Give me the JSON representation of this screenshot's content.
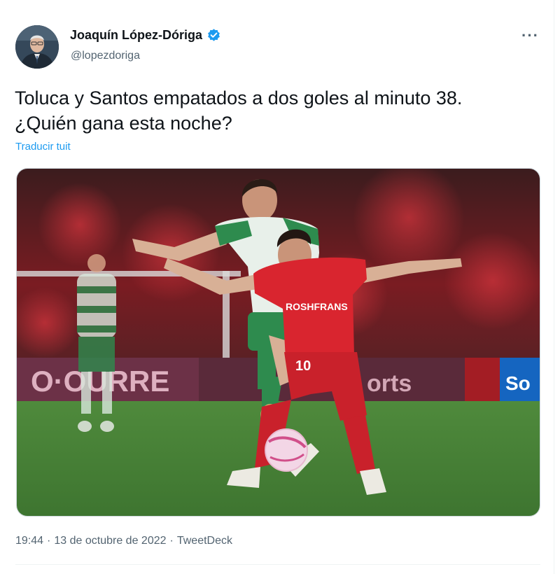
{
  "tweet": {
    "author_name": "Joaquín López-Dóriga",
    "author_handle": "@lopezdoriga",
    "text": "Toluca y Santos empatados a dos goles al minuto 38.\n¿Quién gana esta noche?",
    "translate_label": "Traducir tuit",
    "time": "19:44",
    "separator": "·",
    "date": "13 de octubre de 2022",
    "source": "TweetDeck"
  },
  "photo": {
    "jersey_sponsor": "ROSHFRANS",
    "jersey_number": "10"
  },
  "icons": {
    "more": "more-options-icon",
    "verified": "verified-badge-icon"
  },
  "colors": {
    "accent": "#1d9bf0",
    "text_primary": "#0f1419",
    "text_secondary": "#536471"
  }
}
